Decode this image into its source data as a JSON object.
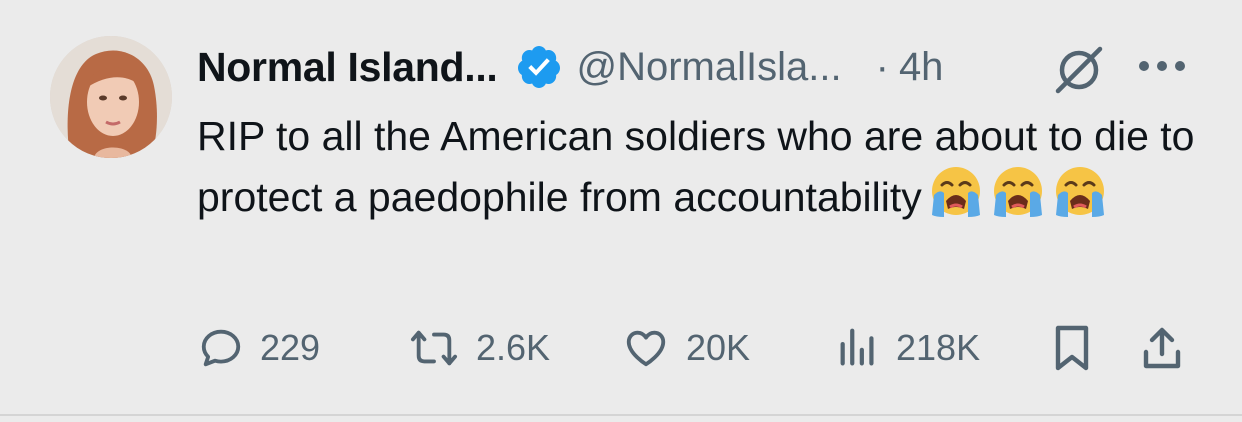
{
  "author": {
    "display_name": "Normal Island...",
    "handle": "@NormalIsla...",
    "separator": "·",
    "time": "4h"
  },
  "tweet": {
    "text": "RIP to all the American soldiers who are about to die to protect a paedophile from accountability",
    "emojis": [
      "loudly-crying-face",
      "loudly-crying-face",
      "loudly-crying-face"
    ]
  },
  "actions": {
    "replies": "229",
    "reposts": "2.6K",
    "likes": "20K",
    "views": "218K"
  },
  "colors": {
    "background": "#ebebeb",
    "text_primary": "#0f1419",
    "text_secondary": "#536471",
    "verified_blue": "#1d9bf0"
  },
  "icons": [
    "verified-badge-icon",
    "grok-icon",
    "more-icon",
    "reply-icon",
    "repost-icon",
    "like-icon",
    "views-icon",
    "bookmark-icon",
    "share-icon"
  ]
}
